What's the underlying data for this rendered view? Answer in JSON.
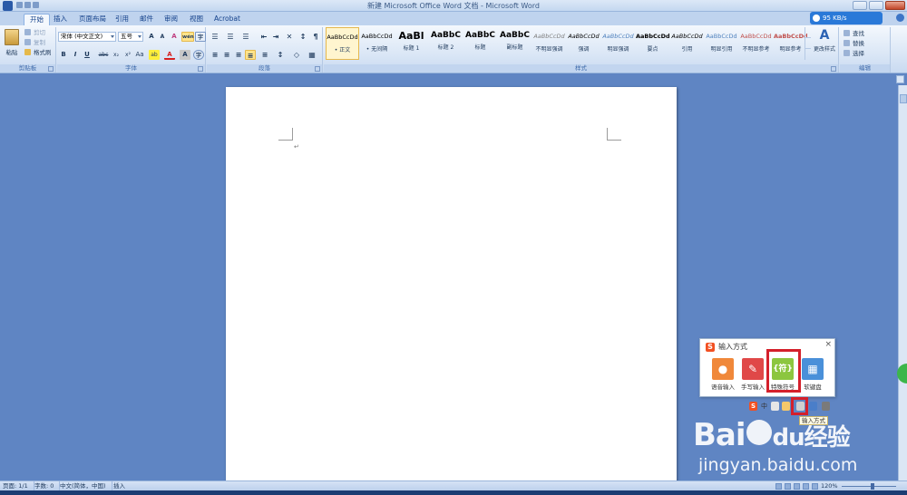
{
  "window": {
    "title": "新建 Microsoft Office Word 文档 - Microsoft Word",
    "speed": "95 KB/s"
  },
  "tabs": [
    {
      "label": "开始",
      "active": true
    },
    {
      "label": "插入"
    },
    {
      "label": "页面布局"
    },
    {
      "label": "引用"
    },
    {
      "label": "邮件"
    },
    {
      "label": "审阅"
    },
    {
      "label": "视图"
    },
    {
      "label": "Acrobat"
    }
  ],
  "ribbon": {
    "clipboard": {
      "paste": "粘贴",
      "cut": "剪切",
      "copy": "复制",
      "format_painter": "格式刷",
      "label": "剪贴板"
    },
    "font": {
      "font_name": "宋体 (中文正文)",
      "font_size": "五号",
      "grow": "A",
      "shrink": "A",
      "clear": "A",
      "phonetic": "wén",
      "bold": "B",
      "italic": "I",
      "underline": "U",
      "strike": "abc",
      "sub": "x₂",
      "sup": "x²",
      "case": "Aa",
      "highlight": "ab",
      "color": "A",
      "char_shading": "A",
      "enclose": "字",
      "label": "字体"
    },
    "paragraph": {
      "label": "段落"
    },
    "styles": {
      "items": [
        {
          "sample": "AaBbCcDd",
          "name": "• 正文"
        },
        {
          "sample": "AaBbCcDd",
          "name": "• 无间隔"
        },
        {
          "sample": "AaBl",
          "name": "标题 1"
        },
        {
          "sample": "AaBbC",
          "name": "标题 2"
        },
        {
          "sample": "AaBbC",
          "name": "标题"
        },
        {
          "sample": "AaBbC",
          "name": "副标题"
        },
        {
          "sample": "AaBbCcDd",
          "name": "不明显强调"
        },
        {
          "sample": "AaBbCcDd",
          "name": "强调"
        },
        {
          "sample": "AaBbCcDd",
          "name": "明显强调"
        },
        {
          "sample": "AaBbCcDd",
          "name": "要点"
        },
        {
          "sample": "AaBbCcDd",
          "name": "引用"
        },
        {
          "sample": "AaBbCcDd",
          "name": "明显引用"
        },
        {
          "sample": "AaBbCcDd",
          "name": "不明显参考"
        },
        {
          "sample": "AaBbCcDd",
          "name": "明显参考"
        }
      ],
      "change_styles": "更改样式",
      "label": "样式"
    },
    "editing": {
      "find": "查找",
      "replace": "替换",
      "select": "选择",
      "label": "编辑"
    }
  },
  "document": {
    "para_mark": "↵"
  },
  "ime": {
    "title": "输入方式",
    "close": "×",
    "options": [
      {
        "label": "语音输入",
        "icon": "microphone-icon",
        "color": "#f0883a",
        "glyph": "🎤"
      },
      {
        "label": "手写输入",
        "icon": "handwriting-icon",
        "color": "#e04848",
        "glyph": "✎"
      },
      {
        "label": "特殊符号",
        "icon": "symbol-icon",
        "color": "#8cc63f",
        "glyph": "{符}"
      },
      {
        "label": "软键盘",
        "icon": "keyboard-icon",
        "color": "#4a90d9",
        "glyph": "⌨"
      }
    ],
    "toolbar_lang": "中",
    "tooltip": "输入方式"
  },
  "status": {
    "page": "页面: 1/1",
    "words": "字数: 0",
    "language": "中文(简体，中国)",
    "mode": "插入",
    "zoom": "120%"
  },
  "watermark": {
    "logo": "Bai",
    "logo2": "百",
    "logo_suffix": "经验",
    "url": "jingyan.baidu.com"
  },
  "colors": {
    "highlight_red": "#d4202b",
    "accent": "#2a79d8"
  }
}
